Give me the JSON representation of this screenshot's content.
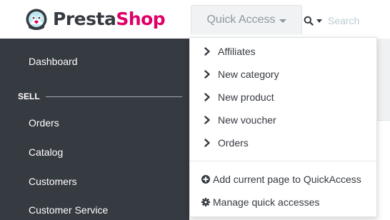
{
  "brand": {
    "name_part1": "Presta",
    "name_part2": "Shop",
    "colors": {
      "dark": "#363a41",
      "pink": "#df0067",
      "cyan": "#25b9d7"
    }
  },
  "header": {
    "quick_access_label": "Quick Access",
    "search": {
      "placeholder": "Search",
      "icon": "search-icon"
    }
  },
  "sidebar": {
    "dashboard_label": "Dashboard",
    "section_label": "SELL",
    "items": [
      {
        "label": "Orders"
      },
      {
        "label": "Catalog"
      },
      {
        "label": "Customers"
      },
      {
        "label": "Customer Service"
      }
    ]
  },
  "quick_access_menu": {
    "links": [
      {
        "label": "Affiliates"
      },
      {
        "label": "New category"
      },
      {
        "label": "New product"
      },
      {
        "label": "New voucher"
      },
      {
        "label": "Orders"
      }
    ],
    "actions": [
      {
        "label": "Add current page to QuickAccess",
        "icon": "plus-circle-icon"
      },
      {
        "label": "Manage quick accesses",
        "icon": "cog-icon"
      }
    ]
  }
}
